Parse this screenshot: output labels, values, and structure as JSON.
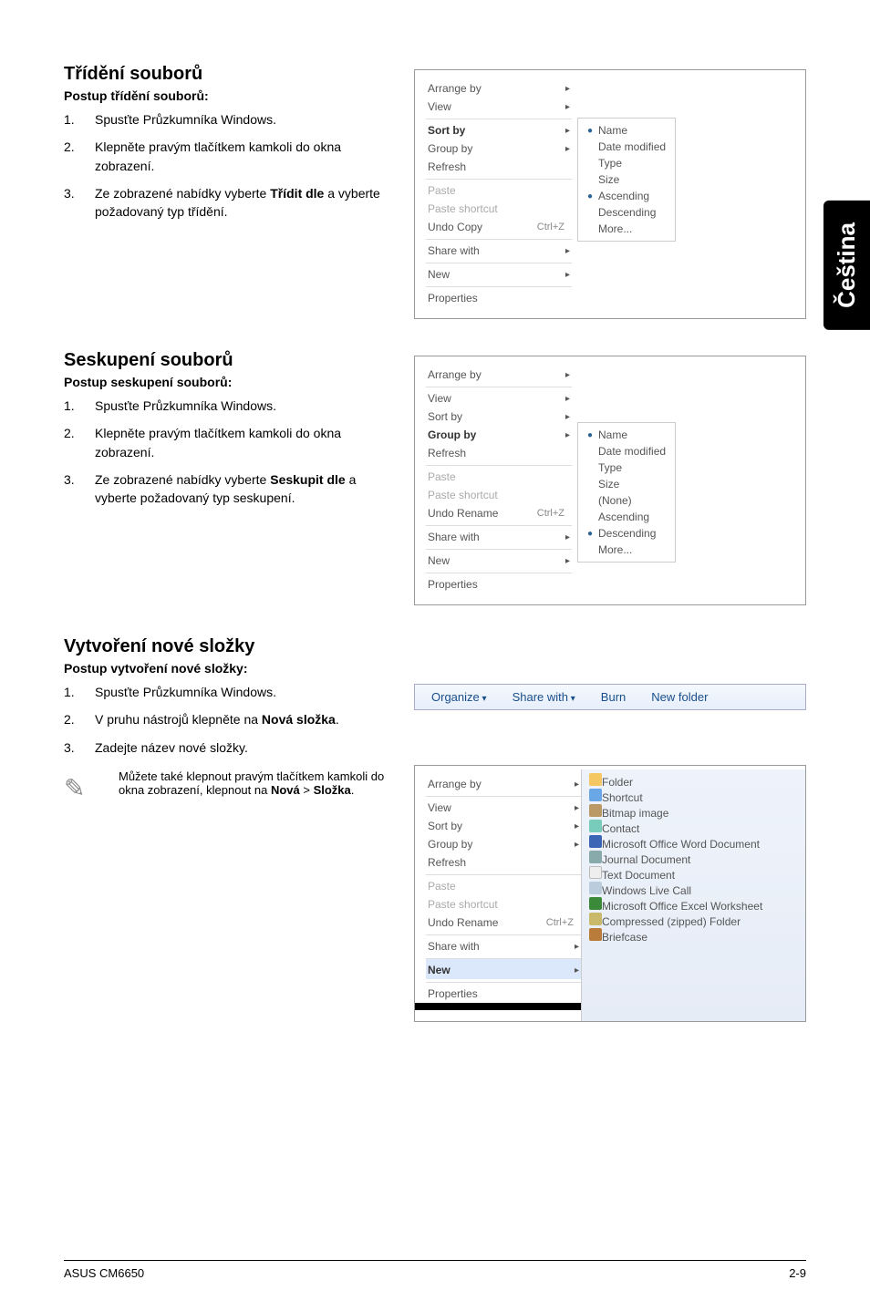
{
  "tab": "Čeština",
  "sections": {
    "sort": {
      "heading": "Třídění souborů",
      "subhead": "Postup třídění souborů:",
      "steps": [
        "Spusťte Průzkumníka Windows.",
        "Klepněte pravým tlačítkem kamkoli do okna zobrazení.",
        "Ze zobrazené nabídky vyberte <b>Třídit dle</b> a vyberte požadovaný typ třídění."
      ],
      "menu": {
        "items": [
          "Arrange by",
          "View",
          "Sort by",
          "Group by",
          "Refresh",
          "Paste",
          "Paste shortcut",
          "Undo Copy",
          "Share with",
          "New",
          "Properties"
        ],
        "shortcut": "Ctrl+Z",
        "sub": [
          "Name",
          "Date modified",
          "Type",
          "Size",
          "Ascending",
          "Descending",
          "More..."
        ]
      }
    },
    "group": {
      "heading": "Seskupení souborů",
      "subhead": "Postup seskupení souborů:",
      "steps": [
        "Spusťte Průzkumníka Windows.",
        "Klepněte pravým tlačítkem kamkoli do okna zobrazení.",
        "Ze zobrazené nabídky vyberte <b>Seskupit dle</b> a vyberte požadovaný typ seskupení."
      ],
      "menu": {
        "items": [
          "Arrange by",
          "View",
          "Sort by",
          "Group by",
          "Refresh",
          "Paste",
          "Paste shortcut",
          "Undo Rename",
          "Share with",
          "New",
          "Properties"
        ],
        "shortcut": "Ctrl+Z",
        "sub": [
          "Name",
          "Date modified",
          "Type",
          "Size",
          "(None)",
          "Ascending",
          "Descending",
          "More..."
        ]
      }
    },
    "newfolder": {
      "heading": "Vytvoření nové složky",
      "subhead": "Postup vytvoření nové složky:",
      "steps": [
        "Spusťte Průzkumníka Windows.",
        "V pruhu nástrojů klepněte na <b>Nová složka</b>.",
        "Zadejte název nové složky."
      ],
      "toolbar": [
        "Organize",
        "Share with",
        "Burn",
        "New folder"
      ],
      "note": "Můžete také klepnout pravým tlačítkem kamkoli do okna zobrazení, klepnout na <b>Nová</b> > <b>Složka</b>.",
      "menu": {
        "items": [
          "Arrange by",
          "View",
          "Sort by",
          "Group by",
          "Refresh",
          "Paste",
          "Paste shortcut",
          "Undo Rename",
          "Share with",
          "New",
          "Properties"
        ],
        "shortcut": "Ctrl+Z",
        "newItems": [
          "Folder",
          "Shortcut",
          "Bitmap image",
          "Contact",
          "Microsoft Office Word Document",
          "Journal Document",
          "Text Document",
          "Windows Live Call",
          "Microsoft Office Excel Worksheet",
          "Compressed (zipped) Folder",
          "Briefcase"
        ]
      }
    }
  },
  "footer": {
    "left": "ASUS CM6650",
    "right": "2-9"
  }
}
